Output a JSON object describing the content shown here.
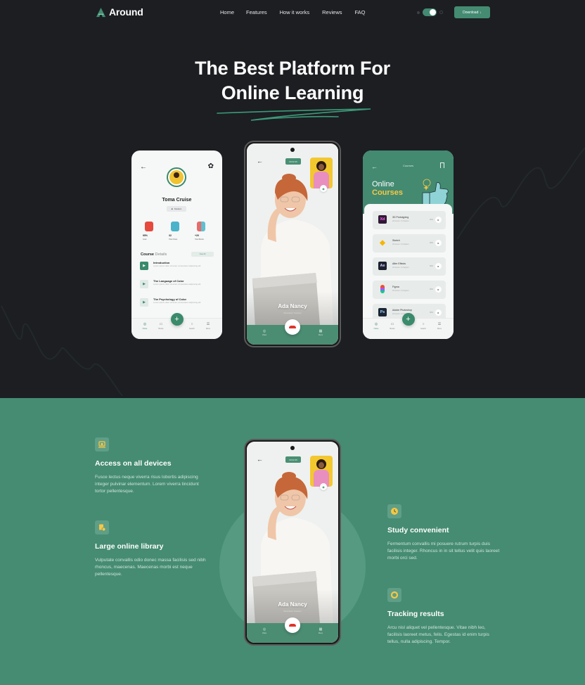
{
  "nav": {
    "brand": "Around",
    "links": [
      "Home",
      "Features",
      "How it works",
      "Reviews",
      "FAQ"
    ],
    "theme_toggle": "on",
    "download_label": "Download",
    "download_icon": "download-arrow-icon"
  },
  "hero": {
    "title_line1": "The Best Platform For",
    "title_line2": "Online Learning"
  },
  "profile_phone": {
    "name": "Toma Cruise",
    "role": "Student",
    "stats": [
      {
        "value": "95%",
        "label": "Goal",
        "color": "#f7ebc7"
      },
      {
        "value": "32",
        "label": "Total Class",
        "color": "#d3e6e0"
      },
      {
        "value": "+20",
        "label": "Total Books",
        "color": "#f6dede"
      }
    ],
    "section_bold": "Course",
    "section_rest": " Details",
    "view_all": "View All",
    "lessons": [
      {
        "title": "Introduction",
        "desc": "Lorem ipsum dolor sit amet, consectetur adipiscing elit"
      },
      {
        "title": "The Language of Color",
        "desc": "Lorem ipsum dolor sit amet, consectetur adipiscing elit"
      },
      {
        "title": "The Psychology of Color",
        "desc": "Lorem ipsum dolor sit amet, consectetur adipiscing elit"
      }
    ],
    "tabs": [
      "Home",
      "Books",
      "Search",
      "Menu"
    ]
  },
  "call_phone": {
    "timer": "00:02:35",
    "caller": "Ada Nancy",
    "caller_sub": "Illustration Teacher",
    "tabs": [
      "Video",
      "Menu"
    ]
  },
  "courses_phone": {
    "title": "Courses",
    "heading_line1": "Online",
    "heading_line2": "Courses",
    "courses": [
      {
        "name": "3D Prototyping",
        "sub": "20 lesson, 6 chapters",
        "pct": "30%",
        "icon": "Xd",
        "bg": "#2e1834",
        "fg": "#ff61f6"
      },
      {
        "name": "Sketch",
        "sub": "20 lesson, 6 chapters",
        "pct": "30%",
        "icon": "◆",
        "bg": "transparent",
        "fg": "#f7b500"
      },
      {
        "name": "After Effects",
        "sub": "20 lesson, 6 chapters",
        "pct": "30%",
        "icon": "Ae",
        "bg": "#1c1f2d",
        "fg": "#d3d7ff"
      },
      {
        "name": "Figma",
        "sub": "20 lesson, 6 chapters",
        "pct": "30%",
        "icon": "F",
        "bg": "transparent",
        "fg": "#f24e1e"
      },
      {
        "name": "Adobe Photoshop",
        "sub": "20 lesson, 6 chapters",
        "pct": "30%",
        "icon": "Ps",
        "bg": "#1a2533",
        "fg": "#9fd5ff"
      }
    ],
    "tabs": [
      "Home",
      "Books",
      "Search",
      "Menu"
    ]
  },
  "features": {
    "items": [
      {
        "title": "Access on all devices",
        "text": "Fusce lectus neque viverra risus lobortis adipiscing integer pulvinar elementum. Lorem viverra tincidunt tortor pellentesque.",
        "icon": "devices-icon"
      },
      {
        "title": "Large online library",
        "text": "Vulputate convallis odio donec massa facilisis sed nibh rhoncus, maecenas. Maecenas morbi est neque pellentesque.",
        "icon": "library-icon"
      },
      {
        "title": "Study convenient",
        "text": "Fermentum convallis mi posuere rutrum turpis duis facilisis integer. Rhoncus in in sit tellus velit quis laoreet morbi orci sed.",
        "icon": "clock-icon"
      },
      {
        "title": "Tracking results",
        "text": "Arcu nisl aliquet vel pellentesque. Vitae nibh leo, facilisis laoreet metus, felis. Egestas id enim turpis tellus, nulla adipiscing. Tempor.",
        "icon": "progress-ring-icon"
      }
    ]
  },
  "colors": {
    "dark_bg": "#1c1e22",
    "accent_green": "#448b72",
    "yellow": "#f6c744"
  }
}
